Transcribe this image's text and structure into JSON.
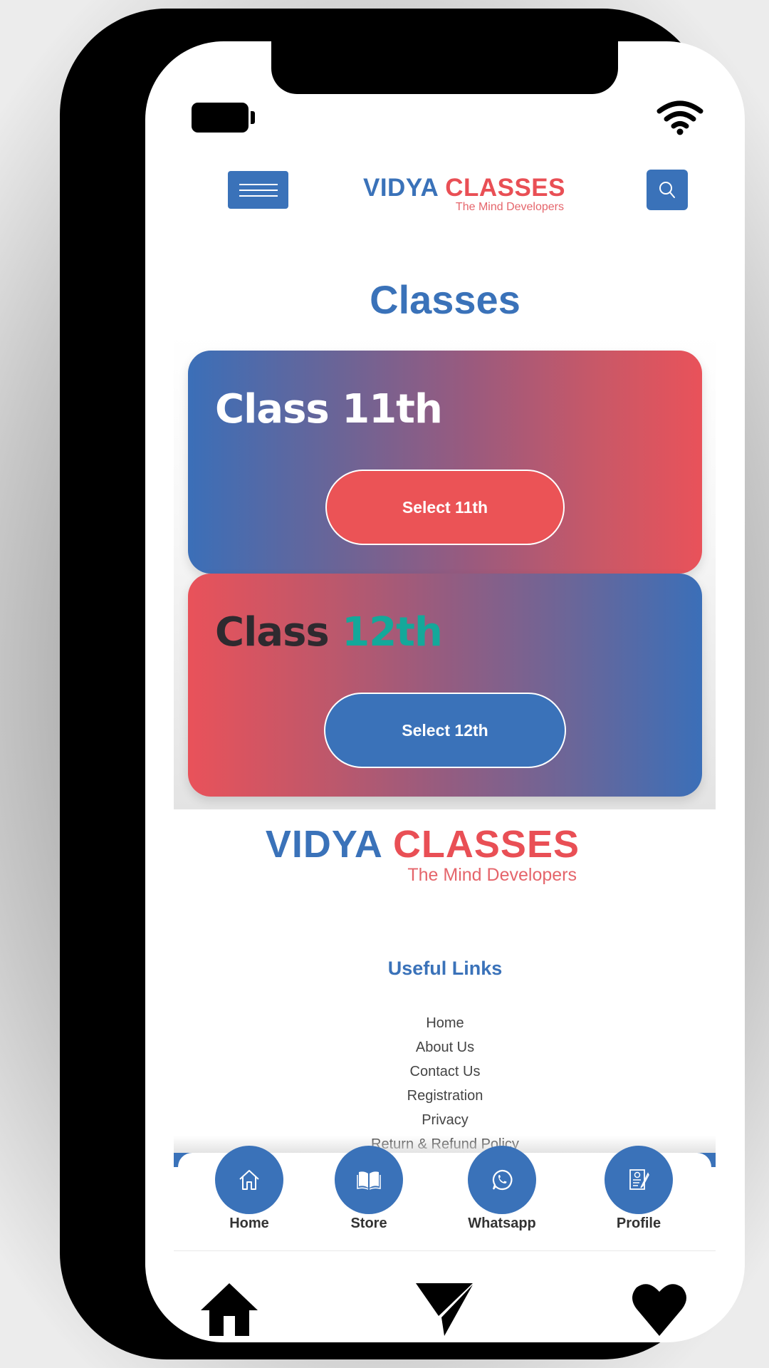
{
  "status_bar": {
    "battery_icon": "battery-icon",
    "wifi_icon": "wifi-icon"
  },
  "header": {
    "menu_icon": "hamburger-menu-icon",
    "logo": {
      "part1": "VIDYA",
      "part2": "CLASSES",
      "tagline": "The Mind Developers"
    },
    "search_icon": "search-icon"
  },
  "page": {
    "title": "Classes"
  },
  "classes": [
    {
      "title_prefix": "Class",
      "title_number": "11th",
      "button_label": "Select 11th"
    },
    {
      "title_prefix": "Class",
      "title_number": "12th",
      "button_label": "Select 12th"
    }
  ],
  "footer": {
    "logo": {
      "part1": "VIDYA",
      "part2": "CLASSES",
      "tagline": "The Mind Developers"
    },
    "useful_links_title": "Useful Links",
    "links": [
      "Home",
      "About Us",
      "Contact Us",
      "Registration",
      "Privacy",
      "Return & Refund Policy"
    ]
  },
  "bottom_nav": [
    {
      "label": "Home",
      "icon": "home-outline-icon"
    },
    {
      "label": "Store",
      "icon": "book-icon"
    },
    {
      "label": "Whatsapp",
      "icon": "whatsapp-icon"
    },
    {
      "label": "Profile",
      "icon": "profile-form-icon"
    }
  ],
  "tab_bar": [
    {
      "icon": "home-icon"
    },
    {
      "icon": "send-icon"
    },
    {
      "icon": "heart-icon"
    }
  ],
  "colors": {
    "brand_blue": "#3a72b9",
    "brand_red": "#e94f55",
    "accent_teal": "#14a89a"
  }
}
